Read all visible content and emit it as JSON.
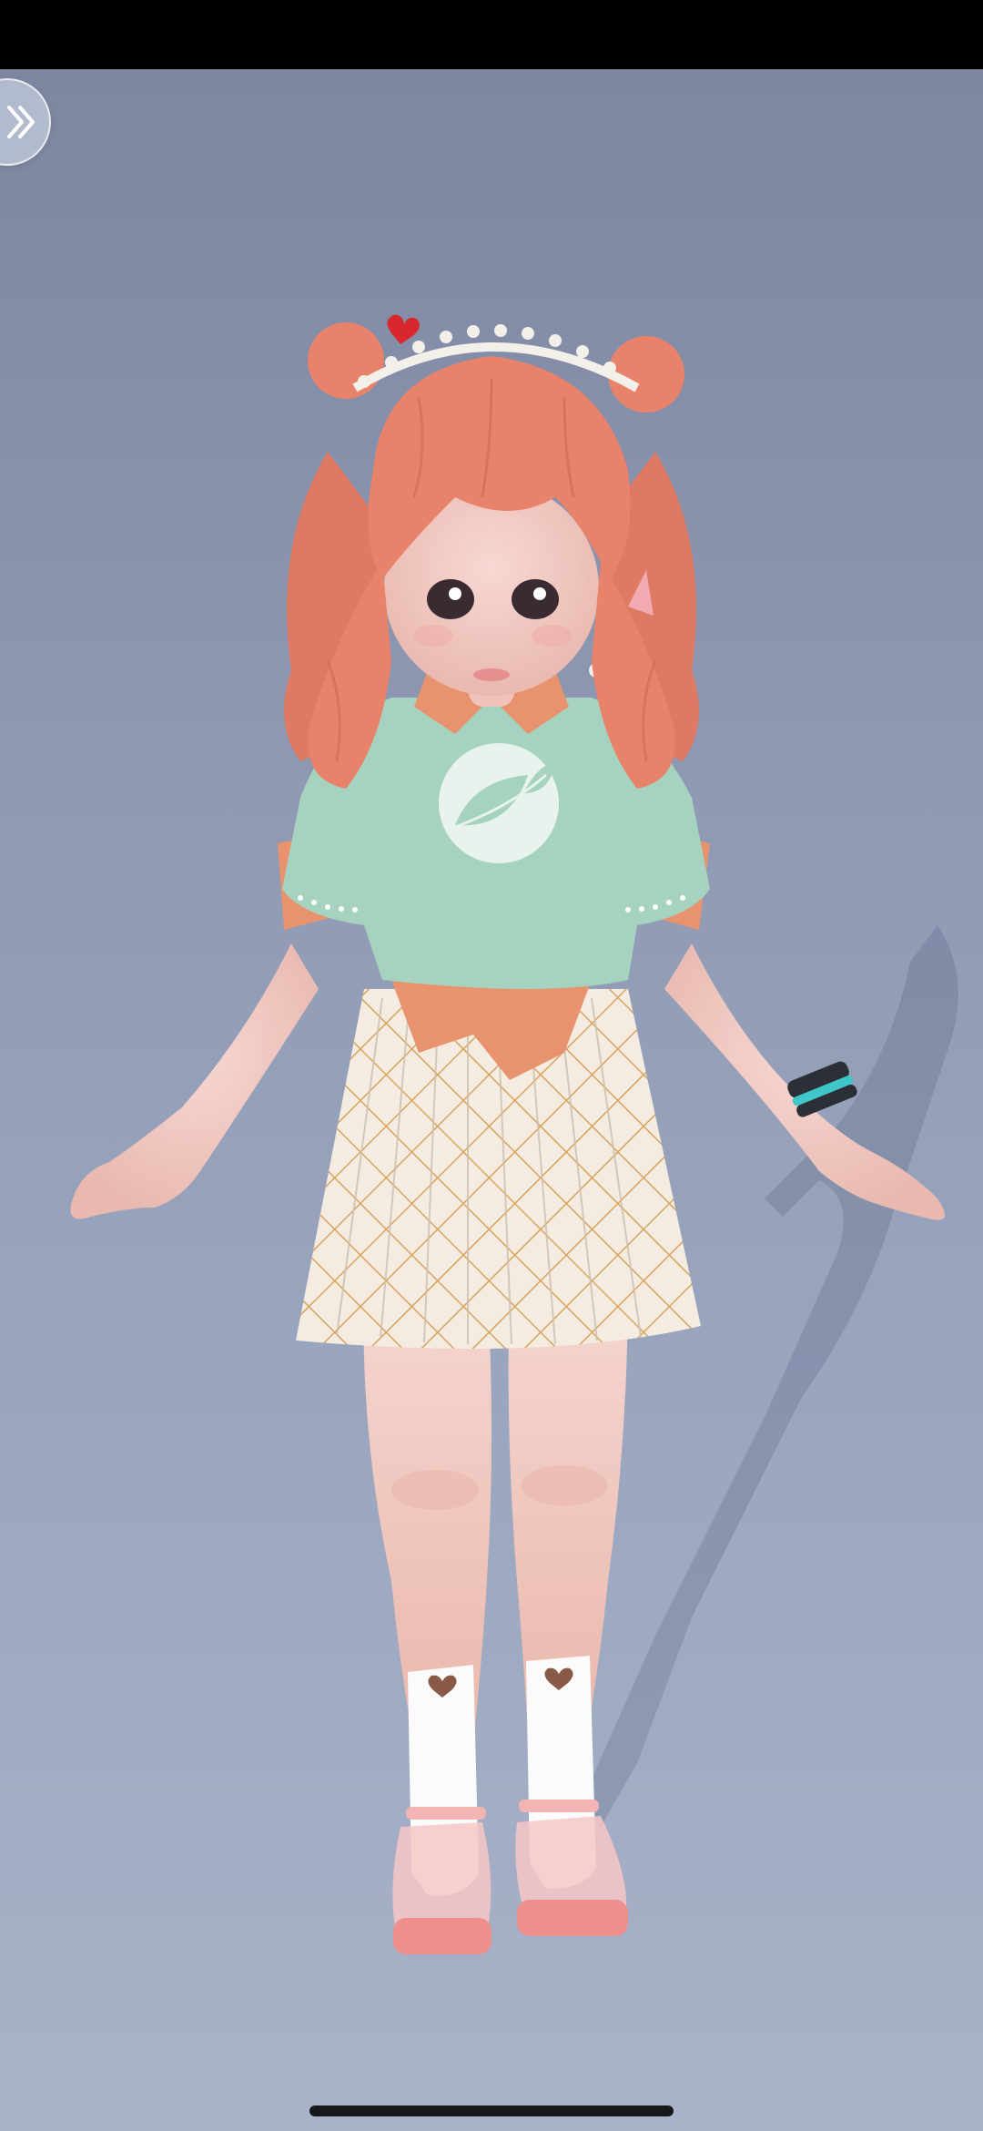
{
  "screen": {
    "background_top": "#7c85a0",
    "background_bottom": "#a8b3c9"
  },
  "controls": {
    "expand_icon": "double-chevron-right-icon"
  },
  "character": {
    "hair_color": "#e8826a",
    "shirt_color": "#a6d3c0",
    "collar_color": "#e8926e",
    "skirt_base": "#f4ece0",
    "skirt_pattern": "#d9a35e",
    "skin_color": "#f2c9c2",
    "sock_color": "#ffffff",
    "shoe_color": "#f29a9a",
    "bracelet_color": "#2b2f36",
    "bracelet_accent": "#3ec6c8"
  }
}
